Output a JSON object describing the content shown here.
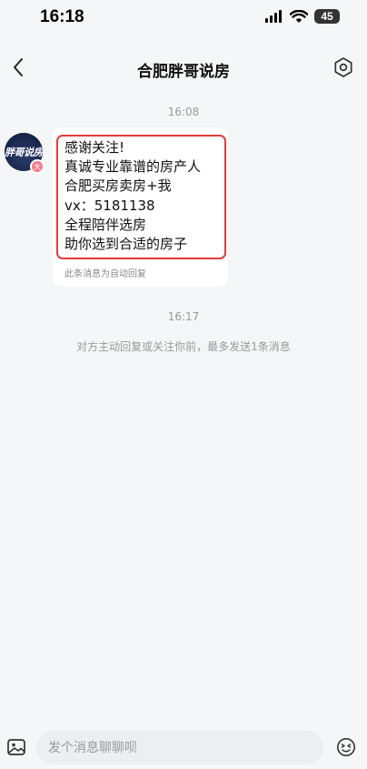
{
  "status_bar": {
    "time": "16:18",
    "battery": "45"
  },
  "header": {
    "title": "合肥胖哥说房"
  },
  "messages": {
    "first_timestamp": "16:08",
    "avatar_text": "胖哥说房",
    "avatar_badge": "大",
    "bubble_lines": [
      "感谢关注!",
      "真诚专业靠谱的房产人",
      "合肥买房卖房+我",
      "vx：5181138",
      "全程陪伴选房",
      "助你选到合适的房子"
    ],
    "auto_reply_note": "此条消息为自动回复",
    "second_timestamp": "16:17",
    "limit_notice": "对方主动回复或关注你前，最多发送1条消息"
  },
  "input_bar": {
    "placeholder": "发个消息聊聊呗"
  },
  "icons": {
    "back": "chevron-left-icon",
    "settings": "hexagon-gear-icon",
    "image": "image-icon",
    "emoji": "emoji-icon"
  },
  "colors": {
    "background": "#f5f6f8",
    "highlight": "#e23b3b",
    "muted_text": "#999999"
  }
}
